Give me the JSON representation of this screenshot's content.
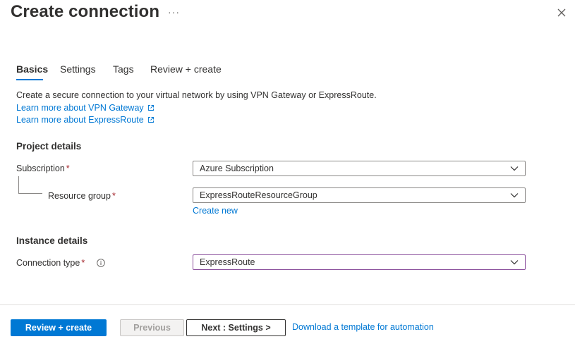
{
  "header": {
    "title": "Create connection",
    "more_label": "···"
  },
  "tabs": [
    {
      "label": "Basics",
      "selected": true
    },
    {
      "label": "Settings"
    },
    {
      "label": "Tags"
    },
    {
      "label": "Review + create"
    }
  ],
  "intro": {
    "description": "Create a secure connection to your virtual network by using VPN Gateway or ExpressRoute.",
    "link_vpn": "Learn more about VPN Gateway",
    "link_expressroute": "Learn more about ExpressRoute"
  },
  "project_details": {
    "heading": "Project details",
    "subscription_label": "Subscription",
    "subscription_value": "Azure Subscription",
    "resource_group_label": "Resource group",
    "resource_group_value": "ExpressRouteResourceGroup",
    "create_new": "Create new",
    "required_mark": "*"
  },
  "instance_details": {
    "heading": "Instance details",
    "connection_type_label": "Connection type",
    "connection_type_value": "ExpressRoute"
  },
  "footer": {
    "review_create": "Review + create",
    "previous": "Previous",
    "next": "Next : Settings >",
    "download_template": "Download a template for automation"
  },
  "colors": {
    "accent": "#0078d4",
    "required": "#a4262c",
    "focused_border": "#8a4f9c"
  }
}
